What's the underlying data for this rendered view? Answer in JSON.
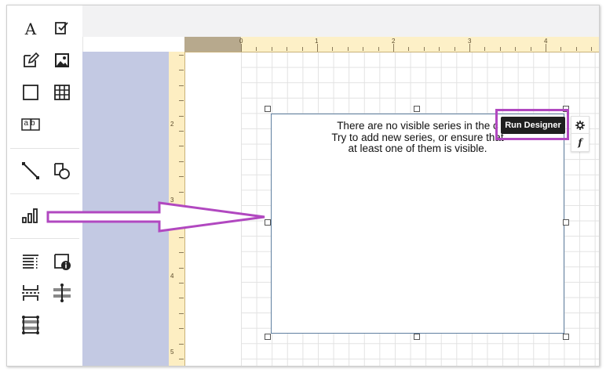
{
  "toolbox": {
    "items": [
      {
        "name": "label-tool",
        "icon": "text-icon"
      },
      {
        "name": "checkbox-tool",
        "icon": "checkbox-icon"
      },
      {
        "name": "richtext-tool",
        "icon": "edit-icon"
      },
      {
        "name": "picture-tool",
        "icon": "image-icon"
      },
      {
        "name": "panel-tool",
        "icon": "square-icon"
      },
      {
        "name": "table-tool",
        "icon": "grid-icon"
      },
      {
        "name": "charactercomb-tool",
        "icon": "charactercomb-icon"
      },
      {
        "name": "line-tool",
        "icon": "line-icon"
      },
      {
        "name": "shape-tool",
        "icon": "shape-icon"
      },
      {
        "name": "chart-tool",
        "icon": "bar-chart-icon"
      },
      {
        "name": "toc-tool",
        "icon": "table-of-contents-icon"
      },
      {
        "name": "pageinfo-tool",
        "icon": "page-info-icon"
      },
      {
        "name": "pagebreak-tool",
        "icon": "page-break-icon"
      },
      {
        "name": "crossband-line-tool",
        "icon": "cross-band-line-icon"
      },
      {
        "name": "crossband-box-tool",
        "icon": "cross-band-box-icon"
      }
    ],
    "charactercomb_label": "ab",
    "text_tool_glyph": "A"
  },
  "rulers": {
    "horizontal": [
      "0",
      "1",
      "2",
      "3",
      "4"
    ],
    "vertical": [
      "2",
      "3",
      "4",
      "5"
    ]
  },
  "chart": {
    "message": "There are no visible series in the c\nTry to add new series, or ensure that\nat least one of them is visible."
  },
  "actions": {
    "run_designer": "Run Designer",
    "settings_icon": "gear-icon",
    "expression_label": "f"
  },
  "colors": {
    "highlight": "#b148c0",
    "band": "#c3c9e3",
    "ruler": "#fdeec2"
  }
}
